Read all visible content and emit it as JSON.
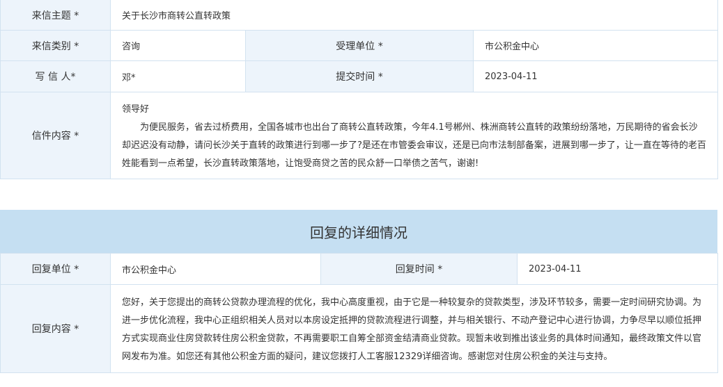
{
  "letter": {
    "subject_label": "来信主题 *",
    "subject_value": "关于长沙市商转公直转政策",
    "category_label": "来信类别 *",
    "category_value": "咨询",
    "unit_label": "受理单位 *",
    "unit_value": "市公积金中心",
    "writer_label": "写 信 人*",
    "writer_value": "邓*",
    "submit_label": "提交时间 *",
    "submit_value": "2023-04-11",
    "content_label": "信件内容 *",
    "content_greeting": "领导好",
    "content_body": "为便民服务，省去过桥费用，全国各城市也出台了商转公直转政策，今年4.1号郴州、株洲商转公直转的政策纷纷落地，万民期待的省会长沙却迟迟没有动静，请问长沙关于直转的政策进行到哪一步了?是还在市管委会审议，还是已向市法制部备案，进展到哪一步了，让一直在等待的老百姓能看到一点希望，长沙直转政策落地，让饱受商贷之苦的民众舒一口举债之苦气，谢谢!"
  },
  "reply": {
    "header_title": "回复的详细情况",
    "unit_label": "回复单位 *",
    "unit_value": "市公积金中心",
    "time_label": "回复时间 *",
    "time_value": "2023-04-11",
    "content_label": "回复内容 *",
    "content_body": "您好，关于您提出的商转公贷款办理流程的优化，我中心高度重视，由于它是一种较复杂的贷款类型，涉及环节较多，需要一定时间研究协调。为进一步优化流程，我中心正组织相关人员对以本房设定抵押的贷款流程进行调整，并与相关银行、不动产登记中心进行协调，力争尽早以顺位抵押方式实现商业住房贷款转住房公积金贷款，不再需要职工自筹全部资金结清商业贷款。现暂未收到推出该业务的具体时间通知，最终政策文件以官网发布为准。如您还有其他公积金方面的疑问，建议您拨打人工客服12329详细咨询。感谢您对住房公积金的关注与支持。"
  }
}
